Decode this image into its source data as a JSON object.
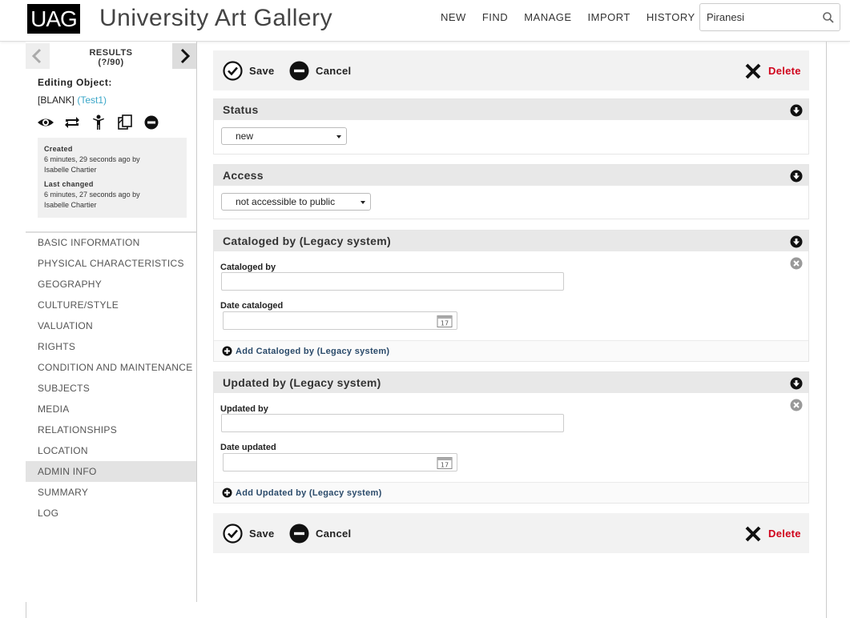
{
  "header": {
    "logo": "UAG",
    "title": "University Art Gallery",
    "nav": [
      "NEW",
      "FIND",
      "MANAGE",
      "IMPORT",
      "HISTORY"
    ],
    "search_value": "Piranesi"
  },
  "sidebar": {
    "results_label": "RESULTS",
    "results_count": "(?/90)",
    "editing_label": "Editing Object:",
    "object_name": "[BLANK]",
    "object_link": "(Test1)",
    "created_label": "Created",
    "created_time": "6 minutes, 29 seconds ago by",
    "created_by": "Isabelle Chartier",
    "changed_label": "Last changed",
    "changed_time": "6 minutes, 27 seconds ago by",
    "changed_by": "Isabelle Chartier",
    "menu": [
      "BASIC INFORMATION",
      "PHYSICAL CHARACTERISTICS",
      "GEOGRAPHY",
      "CULTURE/STYLE",
      "VALUATION",
      "RIGHTS",
      "CONDITION AND MAINTENANCE",
      "SUBJECTS",
      "MEDIA",
      "RELATIONSHIPS",
      "LOCATION",
      "ADMIN INFO",
      "SUMMARY",
      "LOG"
    ],
    "active_menu": "ADMIN INFO"
  },
  "toolbar": {
    "save": "Save",
    "cancel": "Cancel",
    "delete": "Delete"
  },
  "status": {
    "title": "Status",
    "value": "new"
  },
  "access": {
    "title": "Access",
    "value": "not accessible to public"
  },
  "cataloged": {
    "title": "Cataloged by (Legacy system)",
    "by_label": "Cataloged by",
    "by_value": "",
    "date_label": "Date cataloged",
    "date_value": "",
    "add_label": "Add Cataloged by (Legacy system)"
  },
  "updated": {
    "title": "Updated by (Legacy system)",
    "by_label": "Updated by",
    "by_value": "",
    "date_label": "Date updated",
    "date_value": "",
    "add_label": "Add Updated by (Legacy system)"
  },
  "calendar_day": "17",
  "colors": {
    "delete": "#d0021b",
    "link": "#3aa6c8",
    "active_menu_bg": "#e3e3e3"
  }
}
